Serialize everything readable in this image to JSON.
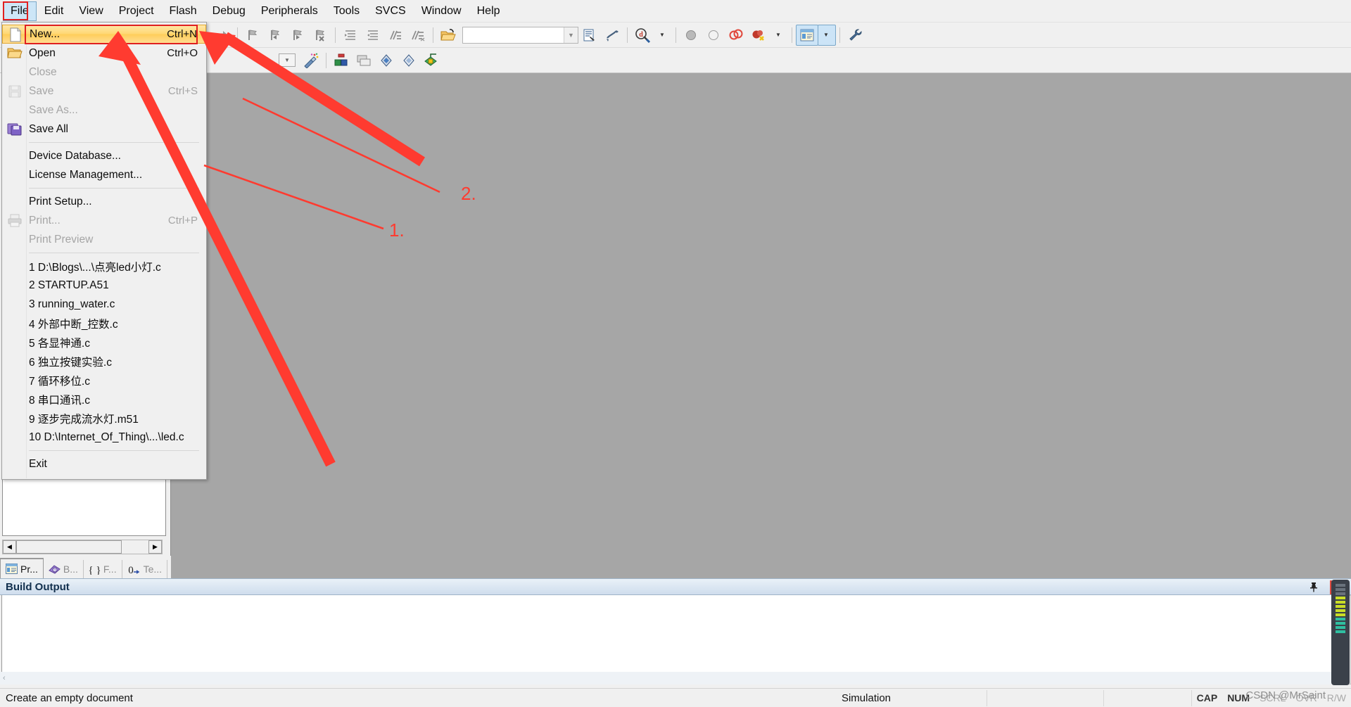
{
  "app": {
    "status_hint": "Create an empty document",
    "watermark": "CSDN @MrSaint"
  },
  "menubar": {
    "items": [
      {
        "label": "File",
        "active": true
      },
      {
        "label": "Edit",
        "active": false
      },
      {
        "label": "View",
        "active": false
      },
      {
        "label": "Project",
        "active": false
      },
      {
        "label": "Flash",
        "active": false
      },
      {
        "label": "Debug",
        "active": false
      },
      {
        "label": "Peripherals",
        "active": false
      },
      {
        "label": "Tools",
        "active": false
      },
      {
        "label": "SVCS",
        "active": false
      },
      {
        "label": "Window",
        "active": false
      },
      {
        "label": "Help",
        "active": false
      }
    ]
  },
  "toolbar": {
    "target_combo_value": "",
    "target_combo_placeholder": "",
    "icons": [
      "back-arrow-icon",
      "forward-arrow-icon",
      "bookmark-toggle-icon",
      "bookmark-prev-icon",
      "bookmark-next-icon",
      "bookmark-clear-icon",
      "indent-right-icon",
      "indent-left-icon",
      "comment-icon",
      "uncomment-icon",
      "open-project-icon",
      "target-options-icon",
      "build-icon",
      "find-in-files-icon",
      "start-debug-icon",
      "insert-breakpoint-icon",
      "kill-breakpoint-icon",
      "disable-breakpoint-icon",
      "kill-all-breakpoints-icon",
      "project-window-icon",
      "configure-icon"
    ]
  },
  "file_menu": {
    "items": [
      {
        "label": "New...",
        "accel": "Ctrl+N",
        "icon": "new-file-icon",
        "state": "highlighted"
      },
      {
        "label": "Open",
        "accel": "Ctrl+O",
        "icon": "open-folder-icon",
        "state": "normal"
      },
      {
        "label": "Close",
        "accel": "",
        "icon": "",
        "state": "disabled"
      },
      {
        "label": "Save",
        "accel": "Ctrl+S",
        "icon": "save-disk-icon",
        "state": "disabled"
      },
      {
        "label": "Save As...",
        "accel": "",
        "icon": "",
        "state": "disabled"
      },
      {
        "label": "Save All",
        "accel": "",
        "icon": "save-all-icon",
        "state": "normal"
      },
      {
        "separator": true
      },
      {
        "label": "Device Database...",
        "accel": "",
        "icon": "",
        "state": "normal"
      },
      {
        "label": "License Management...",
        "accel": "",
        "icon": "",
        "state": "normal"
      },
      {
        "separator": true
      },
      {
        "label": "Print Setup...",
        "accel": "",
        "icon": "",
        "state": "normal"
      },
      {
        "label": "Print...",
        "accel": "Ctrl+P",
        "icon": "printer-icon",
        "state": "disabled"
      },
      {
        "label": "Print Preview",
        "accel": "",
        "icon": "",
        "state": "disabled"
      },
      {
        "separator": true
      },
      {
        "label": "1 D:\\Blogs\\...\\点亮led小灯.c",
        "accel": "",
        "icon": "",
        "state": "normal"
      },
      {
        "label": "2 STARTUP.A51",
        "accel": "",
        "icon": "",
        "state": "normal"
      },
      {
        "label": "3 running_water.c",
        "accel": "",
        "icon": "",
        "state": "normal"
      },
      {
        "label": "4 外部中断_控数.c",
        "accel": "",
        "icon": "",
        "state": "normal"
      },
      {
        "label": "5 各显神通.c",
        "accel": "",
        "icon": "",
        "state": "normal"
      },
      {
        "label": "6 独立按键实验.c",
        "accel": "",
        "icon": "",
        "state": "normal"
      },
      {
        "label": "7 循环移位.c",
        "accel": "",
        "icon": "",
        "state": "normal"
      },
      {
        "label": "8 串口通讯.c",
        "accel": "",
        "icon": "",
        "state": "normal"
      },
      {
        "label": "9 逐步完成流水灯.m51",
        "accel": "",
        "icon": "",
        "state": "normal"
      },
      {
        "label": "10 D:\\Internet_Of_Thing\\...\\led.c",
        "accel": "",
        "icon": "",
        "state": "normal"
      },
      {
        "separator": true
      },
      {
        "label": "Exit",
        "accel": "",
        "icon": "",
        "state": "normal"
      }
    ]
  },
  "project_panel": {
    "tabs": [
      {
        "label": "Pr...",
        "icon": "project-icon",
        "selected": true
      },
      {
        "label": "B...",
        "icon": "books-icon",
        "selected": false
      },
      {
        "label": "F...",
        "icon": "functions-icon",
        "selected": false
      },
      {
        "label": "Te...",
        "icon": "templates-icon",
        "selected": false
      }
    ]
  },
  "build_output": {
    "title": "Build Output",
    "pin_icon": "pin-icon",
    "close_label": "✕",
    "content": ""
  },
  "statusbar": {
    "hint": "Create an empty document",
    "cells": [
      "",
      "Simulation",
      "",
      ""
    ],
    "indicators": [
      {
        "label": "CAP",
        "active": true
      },
      {
        "label": "NUM",
        "active": true
      },
      {
        "label": "SCRL",
        "active": false
      },
      {
        "label": "OVR",
        "active": false
      },
      {
        "label": "R/W",
        "active": false
      }
    ]
  },
  "annotations": {
    "marker_1": "1.",
    "marker_2": "2.",
    "color": "#ff3b30"
  }
}
